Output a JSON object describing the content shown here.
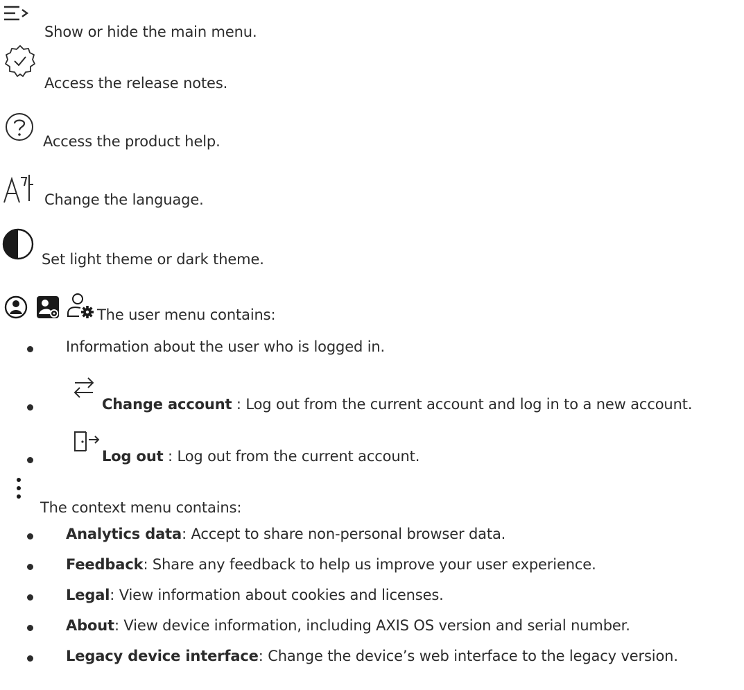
{
  "items": [
    {
      "icon": "main-menu-icon",
      "text": "Show or hide the main menu."
    },
    {
      "icon": "release-notes-icon",
      "text": "Access the release notes."
    },
    {
      "icon": "help-icon",
      "text": "Access the product help."
    },
    {
      "icon": "language-icon",
      "text": "Change the language."
    },
    {
      "icon": "theme-icon",
      "text": "Set light theme or dark theme."
    }
  ],
  "user_menu": {
    "icons": [
      "user-circle-icon",
      "user-settings-filled-icon",
      "user-settings-outline-icon"
    ],
    "text": "The user menu contains:",
    "bullets": [
      {
        "text": "Information about the user who is logged in."
      },
      {
        "icon": "change-account-icon",
        "label": "Change account",
        "text": " : Log out from the current account and log in to a new account."
      },
      {
        "icon": "log-out-icon",
        "label": "Log out",
        "text": " : Log out from the current account."
      }
    ]
  },
  "context_menu": {
    "icon": "more-vertical-icon",
    "text": "The context menu contains:",
    "bullets": [
      {
        "label": "Analytics data",
        "text": ": Accept to share non-personal browser data."
      },
      {
        "label": "Feedback",
        "text": ": Share any feedback to help us improve your user experience."
      },
      {
        "label": "Legal",
        "text": ": View information about cookies and licenses."
      },
      {
        "label": "About",
        "text": ": View device information, including AXIS OS version and serial number."
      },
      {
        "label": "Legacy device interface",
        "text": ": Change the device’s web interface to the legacy version."
      }
    ]
  }
}
